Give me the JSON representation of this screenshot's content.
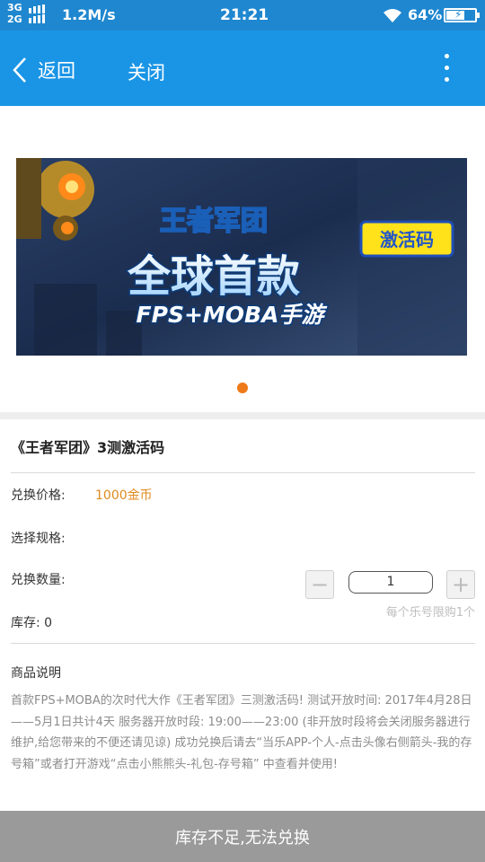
{
  "status_bar": {
    "network": [
      "3G",
      "2G"
    ],
    "speed": "1.2M/s",
    "time": "21:21",
    "battery": "64%",
    "battery_level": 0.64
  },
  "nav": {
    "back_label": "返回",
    "close_label": "关闭"
  },
  "banner": {
    "game_logo": "王者军团",
    "headline": "全球首款",
    "subheadline": "FPS+MOBA手游",
    "badge": "激活码"
  },
  "carousel": {
    "pages": 1,
    "active": 1
  },
  "product": {
    "title": "《王者军团》3测激活码",
    "price_label": "兑换价格:",
    "price_value": "1000金币",
    "spec_label": "选择规格:",
    "qty_label": "兑换数量:",
    "qty_value": "1",
    "qty_minus": "−",
    "qty_plus": "+",
    "limit_note": "每个乐号限购1个",
    "stock_label": "库存:",
    "stock_value": "0"
  },
  "description": {
    "title": "商品说明",
    "body": "首款FPS+MOBA的次时代大作《王者军团》三测激活码! 测试开放时间: 2017年4月28日——5月1日共计4天 服务器开放时段: 19:00——23:00 (非开放时段将会关闭服务器进行维护,给您带来的不便还请见谅) 成功兑换后请去“当乐APP-个人-点击头像右侧箭头-我的存号箱”或者打开游戏“点击小熊熊头-礼包-存号箱” 中查看并使用!"
  },
  "footer": {
    "label": "库存不足,无法兑换"
  },
  "colors": {
    "status_bar": "#1f87cf",
    "nav_bar": "#1a95e6",
    "price": "#e08a1e",
    "dot": "#ee7a1a",
    "footer": "#9a9a9a"
  }
}
